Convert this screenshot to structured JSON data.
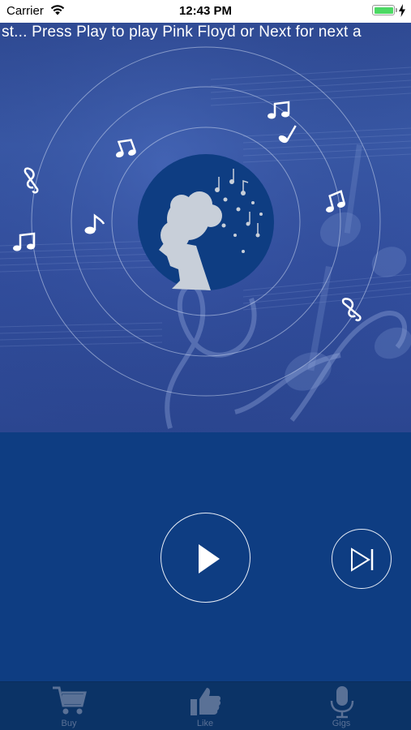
{
  "status_bar": {
    "carrier": "Carrier",
    "time": "12:43 PM"
  },
  "now_playing": {
    "ticker": "st...  Press Play to play Pink Floyd or Next for next a"
  },
  "controls": {
    "play_icon": "play-icon",
    "next_icon": "skip-next-icon"
  },
  "tabs": [
    {
      "label": "Buy",
      "icon": "cart-icon"
    },
    {
      "label": "Like",
      "icon": "thumbs-up-icon"
    },
    {
      "label": "Gigs",
      "icon": "microphone-icon"
    }
  ],
  "colors": {
    "background": "#0e3d82",
    "tab_bar": "#0b3366",
    "tab_inactive": "#5a7196",
    "battery": "#4cd964"
  }
}
